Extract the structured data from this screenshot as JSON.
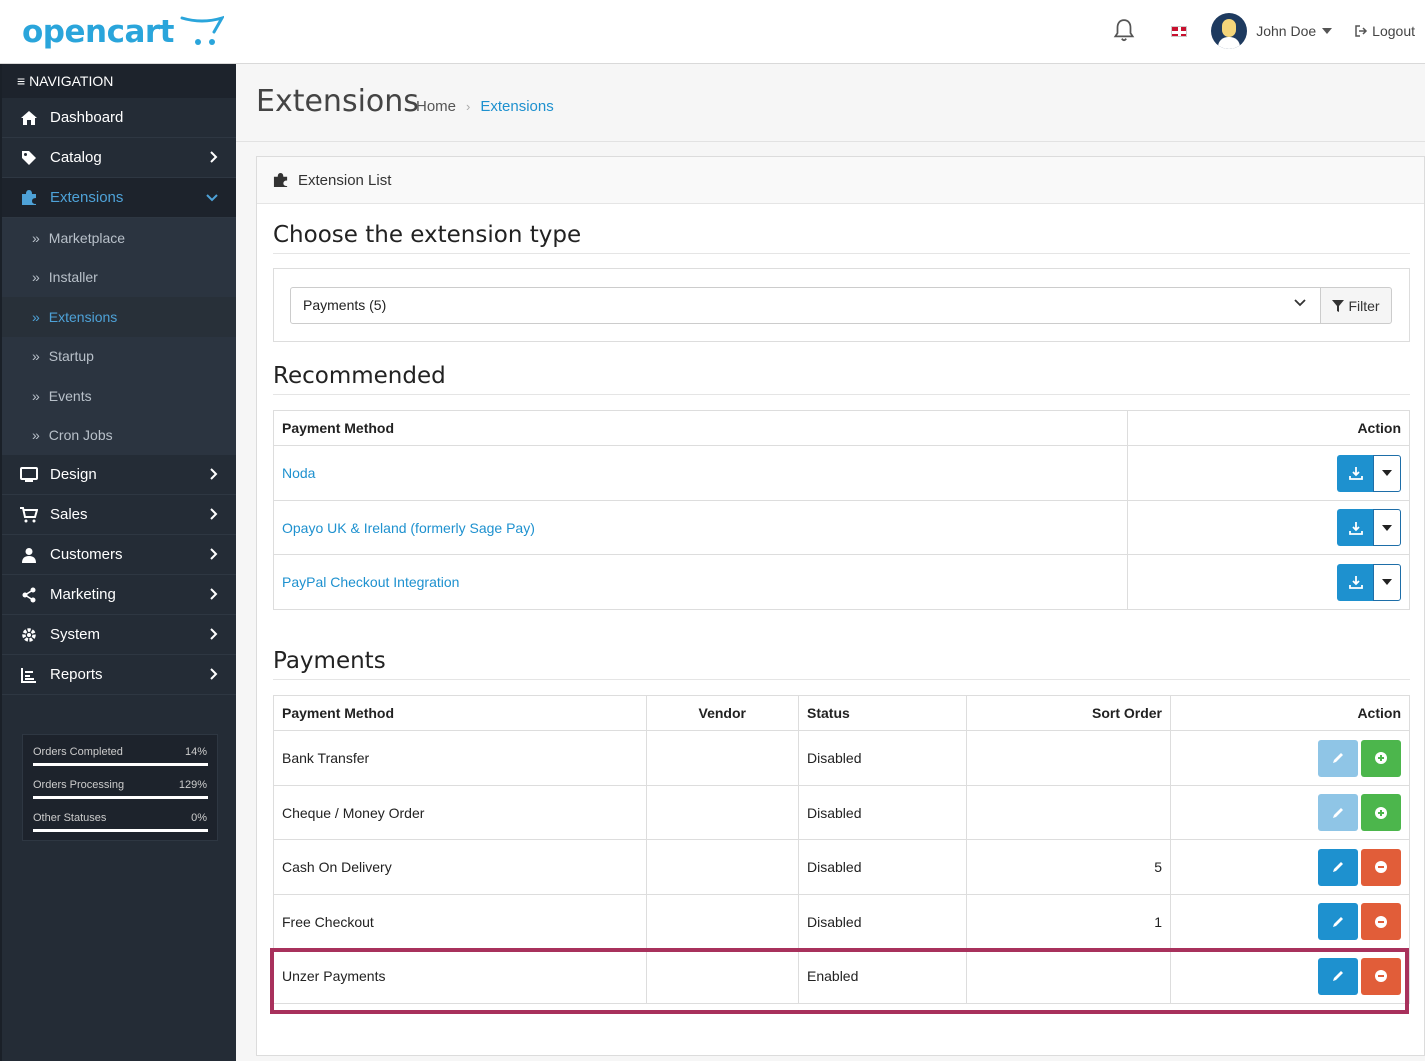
{
  "header": {
    "logo_text": "opencart",
    "user_name": "John Doe",
    "logout_label": "Logout"
  },
  "sidebar": {
    "nav_title": "NAVIGATION",
    "items": [
      {
        "label": "Dashboard",
        "icon": "home-icon"
      },
      {
        "label": "Catalog",
        "icon": "tag-icon"
      },
      {
        "label": "Extensions",
        "icon": "puzzle-icon"
      },
      {
        "label": "Design",
        "icon": "monitor-icon"
      },
      {
        "label": "Sales",
        "icon": "cart-icon"
      },
      {
        "label": "Customers",
        "icon": "user-icon"
      },
      {
        "label": "Marketing",
        "icon": "share-icon"
      },
      {
        "label": "System",
        "icon": "gear-icon"
      },
      {
        "label": "Reports",
        "icon": "chart-icon"
      }
    ],
    "sub_items": [
      "Marketplace",
      "Installer",
      "Extensions",
      "Startup",
      "Events",
      "Cron Jobs"
    ],
    "stats": [
      {
        "label": "Orders Completed",
        "value": "14%"
      },
      {
        "label": "Orders Processing",
        "value": "129%"
      },
      {
        "label": "Other Statuses",
        "value": "0%"
      }
    ]
  },
  "page": {
    "title": "Extensions",
    "breadcrumb_home": "Home",
    "breadcrumb_current": "Extensions",
    "card_title": "Extension List",
    "choose_title": "Choose the extension type",
    "select_value": "Payments (5)",
    "filter_label": "Filter",
    "recommended_title": "Recommended",
    "payments_title": "Payments"
  },
  "recommended": {
    "headers": {
      "method": "Payment Method",
      "action": "Action"
    },
    "rows": [
      {
        "name": "Noda"
      },
      {
        "name": "Opayo UK & Ireland (formerly Sage Pay)"
      },
      {
        "name": "PayPal Checkout Integration"
      }
    ]
  },
  "payments": {
    "headers": {
      "method": "Payment Method",
      "vendor": "Vendor",
      "status": "Status",
      "sort": "Sort Order",
      "action": "Action"
    },
    "rows": [
      {
        "name": "Bank Transfer",
        "vendor": "",
        "status": "Disabled",
        "sort": "",
        "installed": false
      },
      {
        "name": "Cheque / Money Order",
        "vendor": "",
        "status": "Disabled",
        "sort": "",
        "installed": false
      },
      {
        "name": "Cash On Delivery",
        "vendor": "",
        "status": "Disabled",
        "sort": "5",
        "installed": true
      },
      {
        "name": "Free Checkout",
        "vendor": "",
        "status": "Disabled",
        "sort": "1",
        "installed": true
      },
      {
        "name": "Unzer Payments",
        "vendor": "",
        "status": "Enabled",
        "sort": "",
        "installed": true
      }
    ]
  },
  "colors": {
    "accent": "#1e91cf",
    "sidebar_bg": "#242c36",
    "highlight": "#a8315c",
    "install_green": "#4cb64c",
    "uninstall_red": "#e15d39"
  }
}
